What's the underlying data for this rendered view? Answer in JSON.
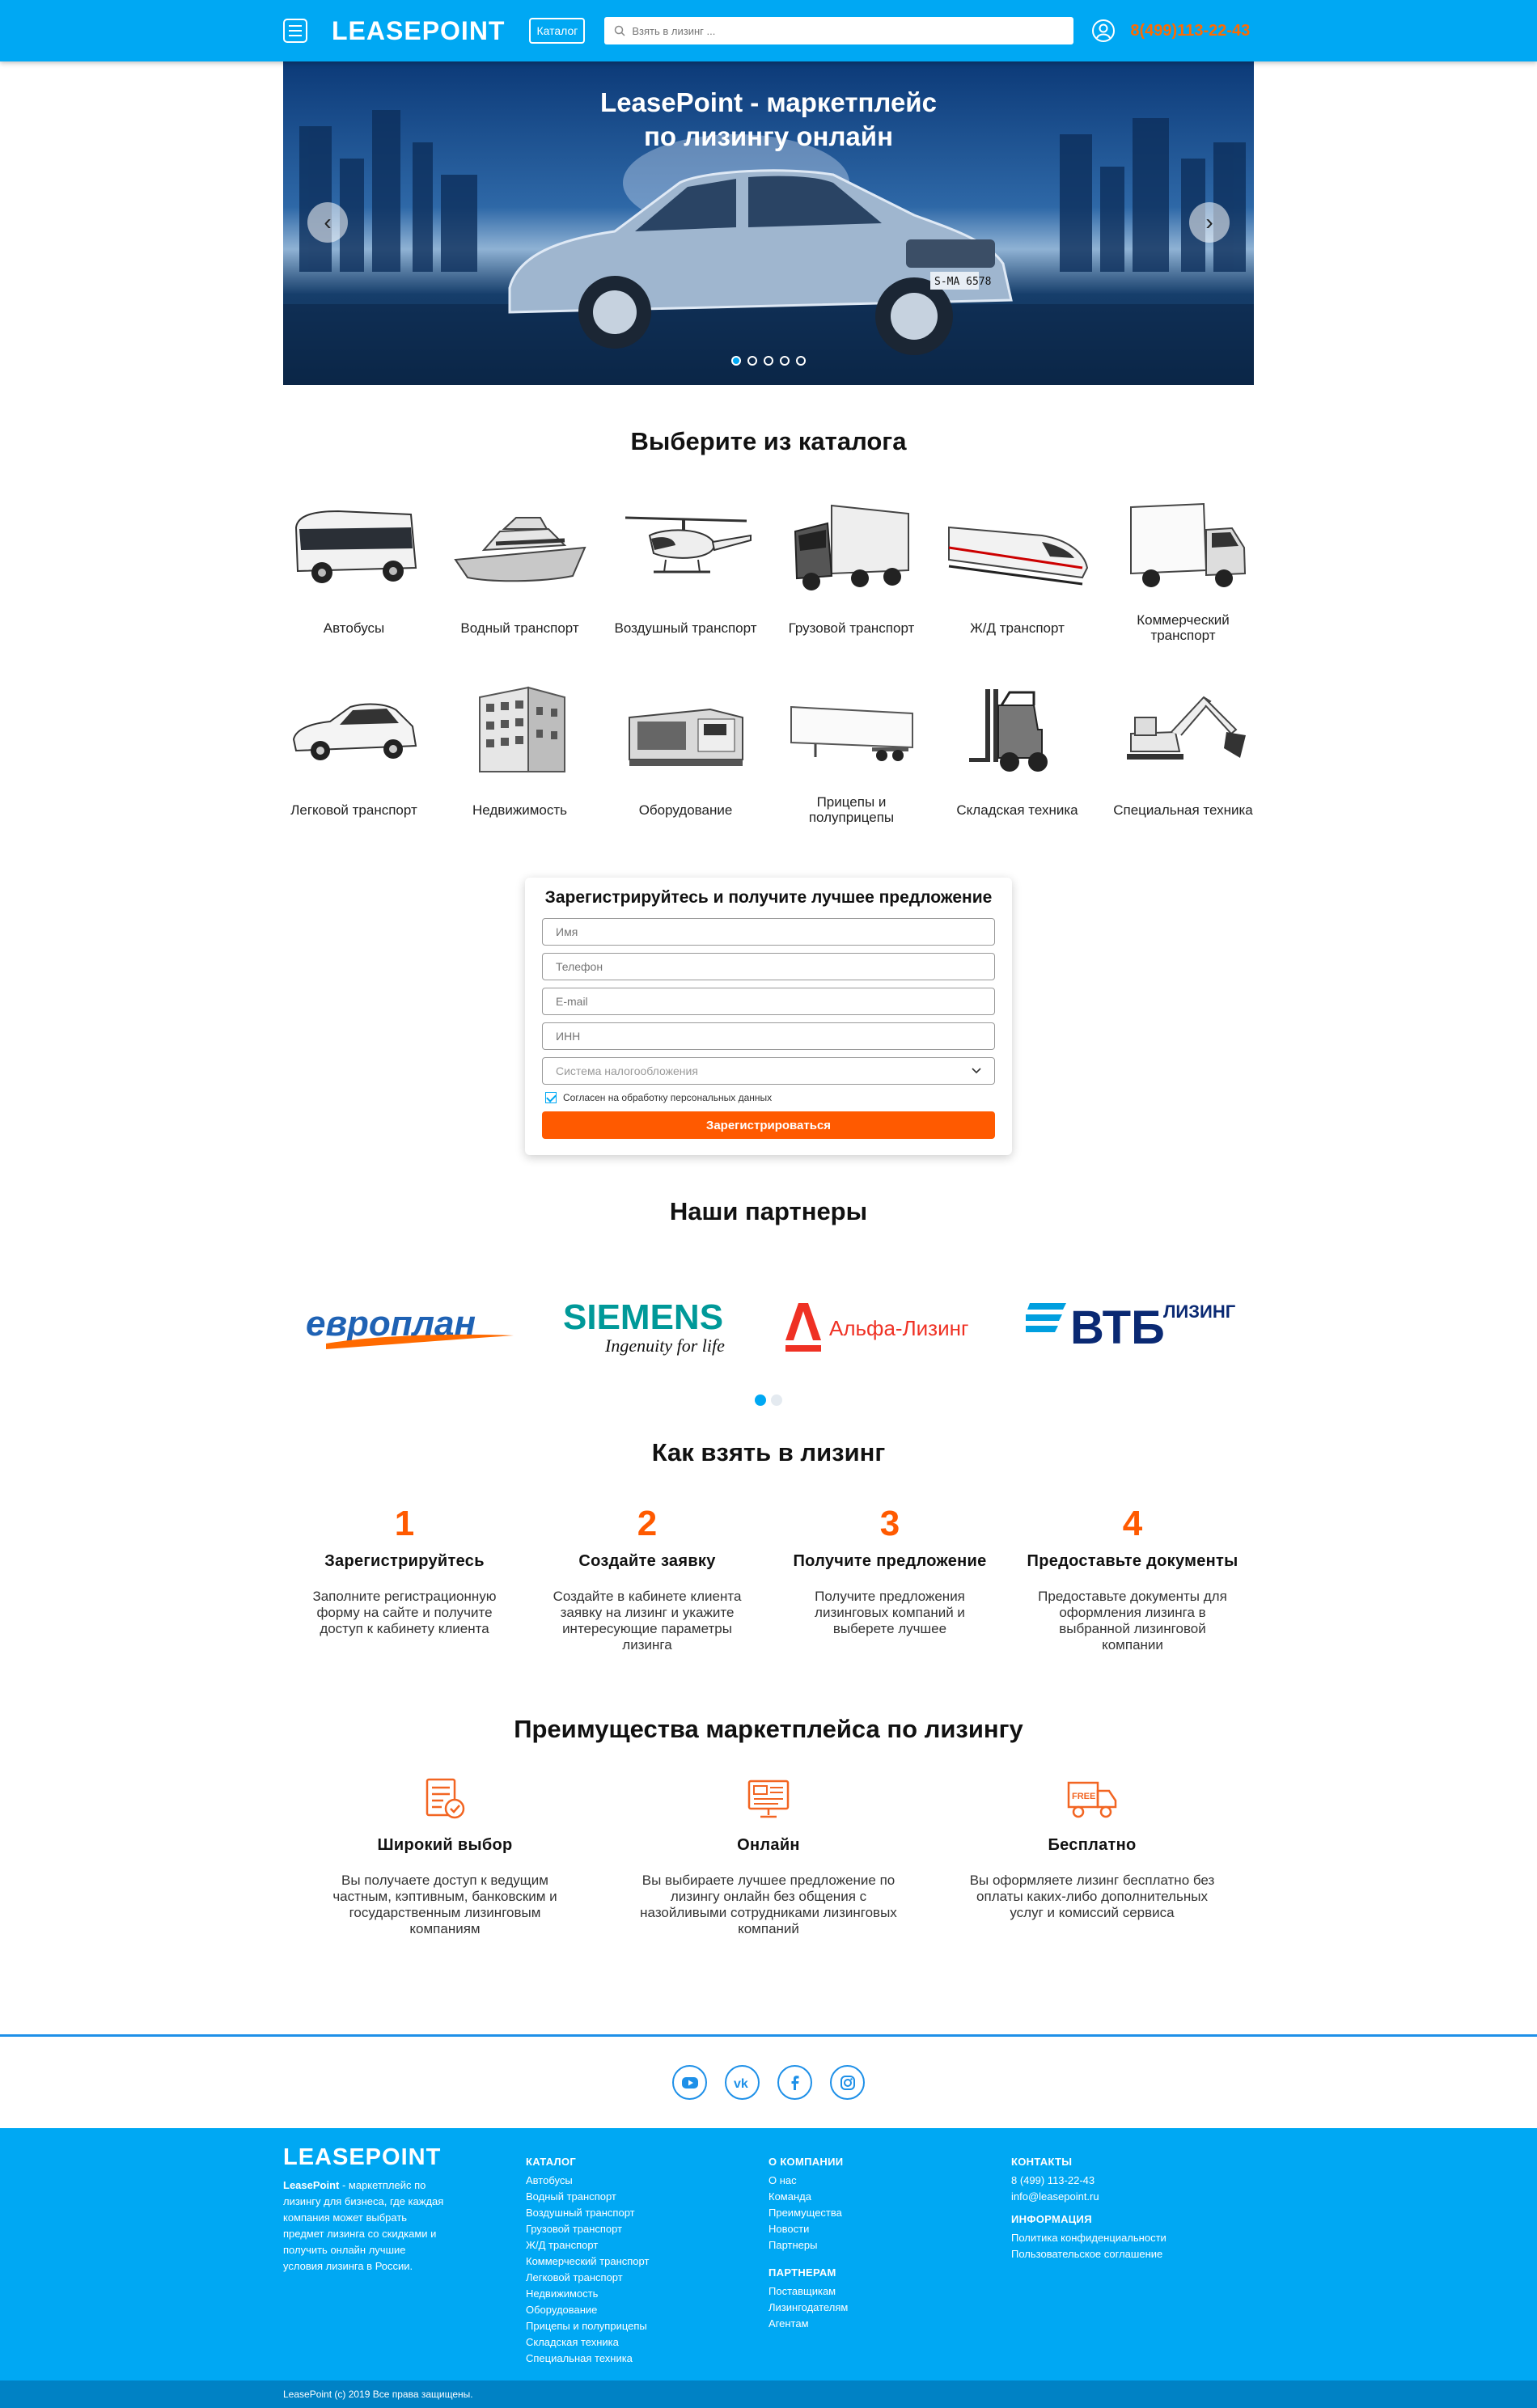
{
  "header": {
    "logo": "LEASEPOINT",
    "catalog_label": "Каталог",
    "search_placeholder": "Взять в лизинг ...",
    "phone": "8(499)113-22-43"
  },
  "hero": {
    "title_line1": "LeasePoint - маркетплейс",
    "title_line2": "по лизингу онлайн",
    "slides_count": 5,
    "active_slide": 1,
    "plate_text": "S-MA 6578"
  },
  "catalog": {
    "title": "Выберите из каталога",
    "items": [
      {
        "label": "Автобусы",
        "icon": "bus-icon"
      },
      {
        "label": "Водный транспорт",
        "icon": "yacht-icon"
      },
      {
        "label": "Воздушный транспорт",
        "icon": "helicopter-icon"
      },
      {
        "label": "Грузовой транспорт",
        "icon": "truck-icon"
      },
      {
        "label": "Ж/Д транспорт",
        "icon": "train-icon"
      },
      {
        "label": "Коммерческий транспорт",
        "icon": "van-icon"
      },
      {
        "label": "Легковой транспорт",
        "icon": "car-icon"
      },
      {
        "label": "Недвижимость",
        "icon": "building-icon"
      },
      {
        "label": "Оборудование",
        "icon": "machine-icon"
      },
      {
        "label": "Прицепы и полуприцепы",
        "icon": "trailer-icon"
      },
      {
        "label": "Складская техника",
        "icon": "forklift-icon"
      },
      {
        "label": "Специальная техника",
        "icon": "excavator-icon"
      }
    ]
  },
  "form": {
    "title": "Зарегистрируйтесь и получите лучшее предложение",
    "name_placeholder": "Имя",
    "phone_placeholder": "Телефон",
    "email_placeholder": "E-mail",
    "inn_placeholder": "ИНН",
    "tax_select": "Система налогообложения",
    "agree_label": "Согласен на обработку персональных данных",
    "agree_checked": true,
    "submit_label": "Зарегистрироваться"
  },
  "partners": {
    "title": "Наши партнеры",
    "items": [
      {
        "name": "европлан",
        "color": "#1f62b4"
      },
      {
        "name": "SIEMENS",
        "tagline": "Ingenuity for life",
        "color": "#009999"
      },
      {
        "name": "Альфа-Лизинг",
        "color": "#ef3124"
      },
      {
        "name": "ВТБ",
        "suffix": "ЛИЗИНГ",
        "color": "#0a2973"
      }
    ],
    "pages": 2,
    "active_page": 1
  },
  "steps": {
    "title": "Как взять в лизинг",
    "items": [
      {
        "num": "1",
        "title": "Зарегистрируйтесь",
        "text": "Заполните регистрационную форму на сайте и получите доступ к кабинету клиента"
      },
      {
        "num": "2",
        "title": "Создайте заявку",
        "text": "Создайте в кабинете клиента заявку на лизинг и укажите интересующие параметры лизинга"
      },
      {
        "num": "3",
        "title": "Получите предложение",
        "text": "Получите предложения лизинговых компаний и выберете лучшее"
      },
      {
        "num": "4",
        "title": "Предоставьте документы",
        "text": "Предоставьте документы для оформления лизинга в выбранной лизинговой компании"
      }
    ]
  },
  "advantages": {
    "title": "Преимущества маркетплейса по лизингу",
    "items": [
      {
        "title": "Широкий выбор",
        "text": "Вы получаете доступ к ведущим частным, кэптивным, банковским и государственным лизинговым компаниям",
        "icon": "checklist-icon"
      },
      {
        "title": "Онлайн",
        "text": "Вы выбираете лучшее предложение по лизингу онлайн без общения с назойливыми сотрудниками лизинговых компаний",
        "icon": "monitor-icon"
      },
      {
        "title": "Бесплатно",
        "text": "Вы оформляете лизинг бесплатно без оплаты каких-либо дополнительных услуг и комиссий сервиса",
        "icon": "free-truck-icon",
        "badge": "FREE"
      }
    ]
  },
  "social": [
    "youtube-icon",
    "vk-icon",
    "facebook-icon",
    "instagram-icon"
  ],
  "social_vk_text": "vk",
  "footer": {
    "logo": "LEASEPOINT",
    "desc_bold": "LeasePoint",
    "desc": " - маркетплейс по лизингу для бизнеса, где каждая компания может выбрать предмет лизинга со скидками и получить онлайн лучшие условия лизинга в России.",
    "catalog_head": "КАТАЛОГ",
    "catalog_links": [
      "Автобусы",
      "Водный транспорт",
      "Воздушный транспорт",
      "Грузовой транспорт",
      "Ж/Д транспорт",
      "Коммерческий транспорт",
      "Легковой транспорт",
      "Недвижимость",
      "Оборудование",
      "Прицепы и полуприцепы",
      "Складская техника",
      "Специальная техника"
    ],
    "company_head": "О КОМПАНИИ",
    "company_links": [
      "О нас",
      "Команда",
      "Преимущества",
      "Новости",
      "Партнеры"
    ],
    "partners_head": "ПАРТНЕРАМ",
    "partners_links": [
      "Поставщикам",
      "Лизингодателям",
      "Агентам"
    ],
    "contacts_head": "КОНТАКТЫ",
    "contacts": [
      "8 (499) 113-22-43",
      "info@leasepoint.ru"
    ],
    "info_head": "ИНФОРМАЦИЯ",
    "info_links": [
      "Политика конфиденциальности",
      "Пользовательское соглашение"
    ],
    "copyright": "LeasePoint (c) 2019 Все права защищены."
  }
}
